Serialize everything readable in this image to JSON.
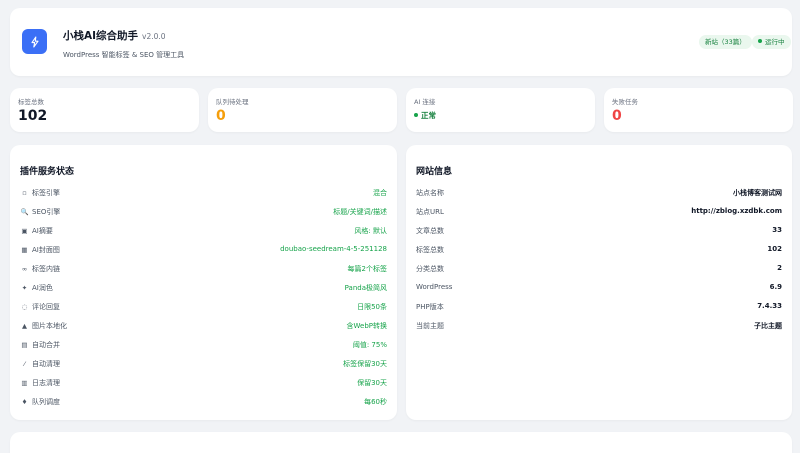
{
  "header": {
    "title": "小栈AI综合助手",
    "version": "v2.0.0",
    "subtitle": "WordPress 智能标签 & SEO 管理工具",
    "badge_site": "新站（33篇）",
    "badge_status": "运行中",
    "logo_icon": "lightning-icon",
    "accent": "#3b6ff6"
  },
  "stats": {
    "tags_label": "标签总数",
    "tags_value": "102",
    "queue_label": "队列待处理",
    "queue_value": "0",
    "ai_label": "AI 连接",
    "ai_value": "正常",
    "failed_label": "失败任务",
    "failed_value": "0"
  },
  "plugin": {
    "title": "插件服务状态",
    "rows": [
      {
        "icon": "tag-icon",
        "glyph": "▫",
        "label": "标签引擎",
        "value": "混合"
      },
      {
        "icon": "search-icon",
        "glyph": "🔍",
        "label": "SEO引擎",
        "value": "标题/关键词/描述"
      },
      {
        "icon": "summary-icon",
        "glyph": "▣",
        "label": "AI摘要",
        "value": "风格: 默认"
      },
      {
        "icon": "cover-icon",
        "glyph": "▦",
        "label": "AI封面图",
        "value": "doubao-seedream-4-5-251128"
      },
      {
        "icon": "link-icon",
        "glyph": "∞",
        "label": "标签内链",
        "value": "每篇2个标签"
      },
      {
        "icon": "sparkle-icon",
        "glyph": "✦",
        "label": "AI润色",
        "value": "Panda极简风"
      },
      {
        "icon": "comment-icon",
        "glyph": "◌",
        "label": "评论回复",
        "value": "日限50条"
      },
      {
        "icon": "image-icon",
        "glyph": "▲",
        "label": "图片本地化",
        "value": "含WebP转换"
      },
      {
        "icon": "merge-icon",
        "glyph": "▤",
        "label": "自动合并",
        "value": "阈值: 75%"
      },
      {
        "icon": "broom-icon",
        "glyph": "⁄",
        "label": "自动清理",
        "value": "标签保留30天"
      },
      {
        "icon": "log-icon",
        "glyph": "▥",
        "label": "日志清理",
        "value": "保留30天"
      },
      {
        "icon": "queue-icon",
        "glyph": "♦",
        "label": "队列调度",
        "value": "每60秒"
      }
    ]
  },
  "site": {
    "title": "网站信息",
    "rows": [
      {
        "label": "站点名称",
        "value": "小栈博客测试网"
      },
      {
        "label": "站点URL",
        "value": "http://zblog.xzdbk.com"
      },
      {
        "label": "文章总数",
        "value": "33"
      },
      {
        "label": "标签总数",
        "value": "102"
      },
      {
        "label": "分类总数",
        "value": "2"
      },
      {
        "label": "WordPress",
        "value": "6.9"
      },
      {
        "label": "PHP版本",
        "value": "7.4.33"
      },
      {
        "label": "当前主题",
        "value": "子比主题"
      }
    ]
  }
}
